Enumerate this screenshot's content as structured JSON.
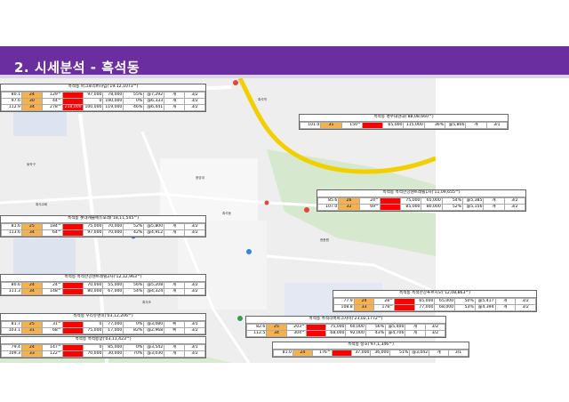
{
  "title": "2. 시세분석 - 흑석동",
  "colors": {
    "header": "#6a2ea0",
    "header_bottom": "#dcd0ea",
    "price_orange": "#f6b04c",
    "price_red": "#ff0000",
    "road_yellow": "#f2cf00"
  },
  "listings": [
    {
      "title": "흑석동 아크로리버하임('19.12,1073^)",
      "rows": [
        [
          "80.1",
          "24",
          "129^",
          "",
          "97,000",
          "78,000",
          "55%",
          "@7,292",
          "개",
          "3/2"
        ],
        [
          "97.6",
          "30",
          "44^",
          "",
          "0",
          "190,000",
          "0%",
          "@6,333",
          "개",
          "3/2"
        ],
        [
          "112.9",
          "34",
          "278^",
          "218,000",
          "100,000",
          "119,000",
          "46%",
          "@6,441",
          "개",
          "3/2"
        ]
      ]
    },
    {
      "title": "흑석동 명수대현대('88,08,660^)",
      "rows": [
        [
          "101.0",
          "31",
          "150^",
          "",
          "65,000",
          "115,000",
          "36%",
          "@5,806",
          "개",
          "3/1"
        ]
      ]
    },
    {
      "title": "흑석동 흑석한강센트레빌1차('11,09,655^)",
      "rows": [
        [
          "85.6",
          "26",
          "24^",
          "",
          "75,000",
          "65,000",
          "54%",
          "@5,385",
          "개",
          "3/2"
        ],
        [
          "107.0",
          "32",
          "69^",
          "",
          "85,000",
          "80,000",
          "52%",
          "@5,156",
          "개",
          "3/2"
        ]
      ]
    },
    {
      "title": "흑석동 롯데캐슬에듀포레('18,11,545^)",
      "rows": [
        [
          "81.6",
          "25",
          "184^",
          "",
          "75,000",
          "70,000",
          "52%",
          "@5,800",
          "개",
          "3/2"
        ],
        [
          "113.6",
          "34",
          "64^",
          "",
          "97,000",
          "70,000",
          "42%",
          "@4,912",
          "개",
          "3/2"
        ]
      ]
    },
    {
      "title": "흑석동 흑석한강센트레빌2차('12,12,963^)",
      "rows": [
        [
          "80.6",
          "24",
          "24^",
          "",
          "70,000",
          "55,000",
          "56%",
          "@5,208",
          "개",
          "3/2"
        ],
        [
          "111.3",
          "34",
          "148^",
          "",
          "80,000",
          "67,000",
          "54%",
          "@4,324",
          "개",
          "3/2"
        ]
      ]
    },
    {
      "title": "흑석동 흑석한강푸르지오('12,08,863^)",
      "rows": [
        [
          "77.9",
          "24",
          "28^",
          "",
          "65,000",
          "65,000",
          "50%",
          "@5,417",
          "개",
          "3/2"
        ],
        [
          "108.8",
          "33",
          "178^",
          "",
          "77,000",
          "68,000",
          "53%",
          "@4,394",
          "개",
          "3/2"
        ]
      ]
    },
    {
      "title": "흑석동 우리유앤미('03,12,206^)",
      "rows": [
        [
          "81.7",
          "25",
          "31^",
          "",
          "0",
          "77,000",
          "0%",
          "@3,080",
          "복",
          "3/1"
        ],
        [
          "103.1",
          "31",
          "68^",
          "",
          "75,000",
          "17,000",
          "82%",
          "@2,968",
          "복",
          "3/2"
        ]
      ]
    },
    {
      "title": "흑석동 흑석리버파크자이('23,02,1772^)",
      "rows": [
        [
          "82.6",
          "25",
          "203^",
          "",
          "75,000",
          "60,000",
          "56%",
          "@5,400",
          "개",
          "3/2"
        ],
        [
          "112.5",
          "34",
          "304^",
          "",
          "68,000",
          "92,000",
          "43%",
          "@4,706",
          "개",
          "3/2"
        ]
      ]
    },
    {
      "title": "흑석동 흑석동양('03,11,423^)",
      "rows": [
        [
          "79.4",
          "24",
          "147^",
          "",
          "0",
          "85,000",
          "0%",
          "@3,542",
          "개",
          "3/1"
        ],
        [
          "109.3",
          "33",
          "122^",
          "",
          "70,000",
          "30,000",
          "70%",
          "@3,030",
          "개",
          "3/2"
        ]
      ]
    },
    {
      "title": "흑석동 청호('97,1,346^)",
      "rows": [
        [
          "81.0",
          "24",
          "176^",
          "",
          "37,000",
          "36,000",
          "51%",
          "@3,042",
          "개",
          "3/1"
        ]
      ]
    }
  ],
  "map_labels": [
    "흑석역",
    "흑석동",
    "흑석초",
    "중앙대",
    "현충원",
    "흑석교회",
    "은로초",
    "서달산",
    "동작구"
  ]
}
